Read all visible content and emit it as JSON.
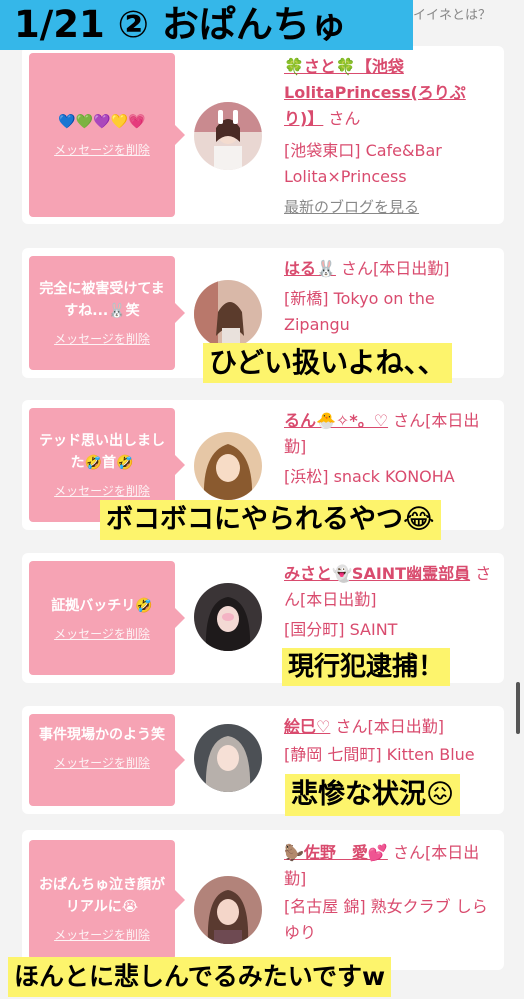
{
  "header": {
    "title": "1/21 ② おぱんちゅ",
    "link": "イイネとは？"
  },
  "messages": [
    {
      "text": "💙💚💜💛💗",
      "delete_label": "メッセージを削除",
      "name": "🍀さと🍀【池袋LolitaPrincess(ろりぷり)】",
      "suffix": "さん",
      "shop": "[池袋東口] Cafe&Bar Lolita×Princess",
      "blog_link": "最新のブログを見る"
    },
    {
      "text": "完全に被害受けてますね...🐰笑",
      "delete_label": "メッセージを削除",
      "name": "はる🐰",
      "suffix": "さん[本日出勤]",
      "shop": "[新橋] Tokyo on the Zipangu"
    },
    {
      "text": "テッド思い出しました🤣首🤣",
      "delete_label": "メッセージを削除",
      "name": "るん🐣✧*。♡",
      "suffix": "さん[本日出勤]",
      "shop": "[浜松] snack KONOHA"
    },
    {
      "text": "証拠バッチリ🤣",
      "delete_label": "メッセージを削除",
      "name": "みさと👻SAINT幽霊部員",
      "suffix": "さん[本日出勤]",
      "shop": "[国分町] SAINT"
    },
    {
      "text": "事件現場かのよう笑",
      "delete_label": "メッセージを削除",
      "name": "絵巳♡",
      "suffix": "さん[本日出勤]",
      "shop": "[静岡 七間町] Kitten Blue"
    },
    {
      "text": "おぱんちゅ泣き顔がリアルに😭",
      "delete_label": "メッセージを削除",
      "name": "🦫佐野　愛💕",
      "suffix": "さん[本日出勤]",
      "shop": "[名古屋 錦] 熟女クラブ しらゆり"
    }
  ],
  "captions": {
    "c1": "ひどい扱いよね、、",
    "c2": "ボコボコにやられるやつ😂",
    "c3": "現行犯逮捕！",
    "c4": "悲惨な状況😖",
    "c5": "ほんとに悲しんでるみたいですw"
  },
  "colors": {
    "banner": "#35b7e9",
    "bubble": "#f6a3b4",
    "link": "#d94b6e",
    "caption": "#fdf46c"
  }
}
